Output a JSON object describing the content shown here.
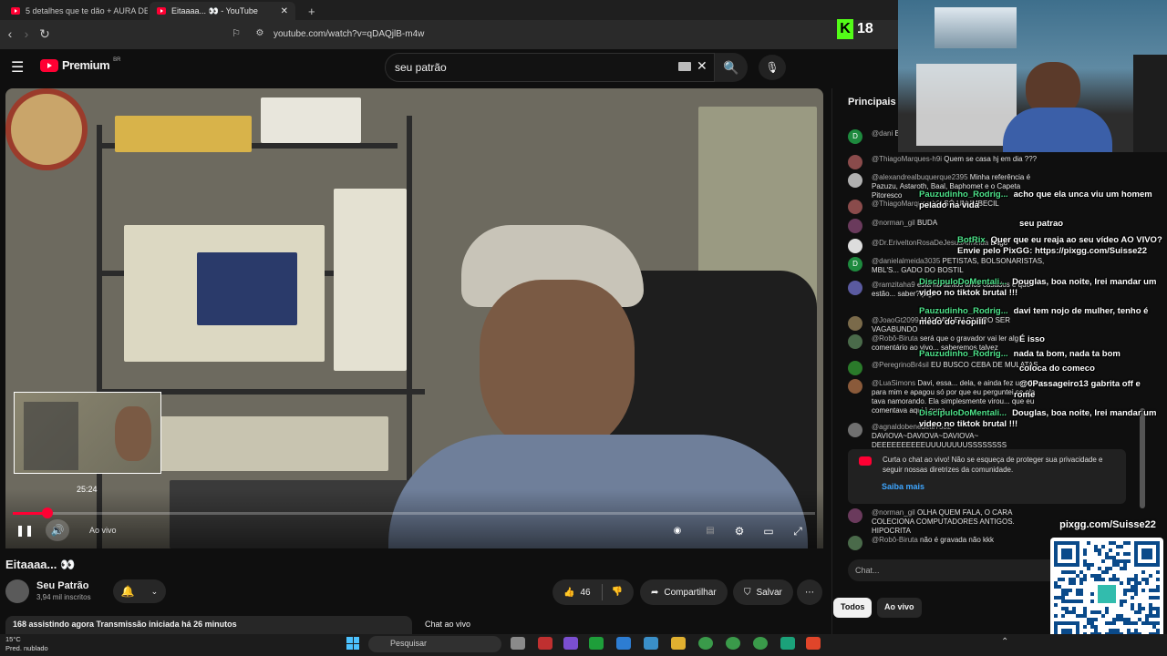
{
  "browser": {
    "tabs": [
      {
        "label": "5 detalhes que te dão + AURA DE H",
        "active": false
      },
      {
        "label": "Eitaaaa... 👀 - YouTube",
        "active": true
      }
    ],
    "new_tab": "+",
    "url": "youtube.com/watch?v=qDAQjlB-m4w"
  },
  "yt": {
    "brand": "Premium",
    "brand_region": "BR",
    "search_value": "seu patrão",
    "clear_glyph": "✕",
    "search_glyph": "🔍",
    "mic_glyph": "🎙"
  },
  "player": {
    "preview_time": "25:24",
    "live_label": "Ao vivo",
    "progress_fraction": 0.043
  },
  "video": {
    "title": "Eitaaaa... 👀",
    "channel": "Seu Patrão",
    "subscribers": "3,94 mil inscritos",
    "likes": "46",
    "share": "Compartilhar",
    "save": "Salvar",
    "info": "168 assistindo agora  Transmissão iniciada há 26 minutos"
  },
  "chat": {
    "header": "Principais m",
    "footer_label": "Chat ao vivo",
    "messages": [
      {
        "author": "@dani",
        "text": "BOSTIL",
        "color": "#1e8a3e",
        "initial": "D"
      },
      {
        "author": "@ThiagoMarques-h9i",
        "text": "Quem se casa hj em dia ???",
        "color": "#8a4b4b",
        "initial": ""
      },
      {
        "author": "@alexandrealbuquerque2395",
        "text": "Minha referência é Pazuzu, Astaroth, Baal, Baphomet e o Capeta Pitoresco",
        "color": "#b0b0b0",
        "initial": ""
      },
      {
        "author": "@ThiagoMarques-h9i",
        "text": "SÓ UM IMBECIL",
        "color": "#8a4b4b",
        "initial": ""
      },
      {
        "author": "@norman_gil",
        "text": "BUDA",
        "color": "#6a3a5c",
        "initial": ""
      },
      {
        "author": "@Dr.EriveltonRosaDeJesusAlmeida",
        "text": "Bago",
        "color": "#dddddd",
        "initial": ""
      },
      {
        "author": "@danielalmeida3035",
        "text": "PETISTAS, BOLSONARISTAS, MBL'S... GADO DO BOSTIL",
        "color": "#1e8a3e",
        "initial": "D"
      },
      {
        "author": "@ramzitaha9",
        "text": "está há tantos anos casados e que estão... saber?!pqp!",
        "color": "#5a5aa0",
        "initial": ""
      },
      {
        "author": "@JoaoGt2099",
        "text": "MAI DAVI EU QUERO SER VAGABUNDO",
        "color": "#7a6a4a",
        "initial": ""
      },
      {
        "author": "@Robô-Biruta",
        "text": "será que o gravador vai ler algo comentário ao vivo... saberemos talvez",
        "color": "#4a6a4a",
        "initial": ""
      },
      {
        "author": "@PeregrinoBr4sil",
        "text": "EU BUSCO CEBA DE MULATAS",
        "color": "#2a7a2a",
        "initial": ""
      },
      {
        "author": "@LuaSimons",
        "text": "Davi, essa... dela, e ainda fez um video para mim e apagou só por que eu perguntei se ela tava namorando. Ela simplesmente virou... que eu comentava aqui.Louca",
        "color": "#8a5a3a",
        "initial": ""
      },
      {
        "author": "@agnaldobenedetti7532",
        "text": "DAVIOVA~DAVIOVA~DAVIOVA~ DEEEEEEEEEEUUUUUUUUSSSSSSSS",
        "color": "#707070",
        "initial": ""
      },
      {
        "author": "@norman_gil",
        "text": "OLHA QUEM FALA, O CARA COLECIONA COMPUTADORES ANTIGOS. HIPOCRITA",
        "color": "#6a3a5c",
        "initial": ""
      },
      {
        "author": "@Robô-Biruta",
        "text": "não é gravada não kkk",
        "color": "#4a6a4a",
        "initial": ""
      }
    ],
    "notice": "Curta o chat ao vivo! Não se esqueça de proteger sua privacidade e seguir nossas diretrizes da comunidade.",
    "learn_more": "Saiba mais",
    "input_placeholder": "Chat...",
    "chips": [
      "Todos",
      "Ao vivo"
    ]
  },
  "overlay": {
    "kick_count": "18",
    "kick_letter": "K",
    "messages": [
      {
        "user": "Pauzudinho_Rodrig...",
        "text": "acho que ela unca viu um homem pelado na vida"
      },
      {
        "user": "",
        "text": "seu patrao"
      },
      {
        "user": "BotRix",
        "text": "Quer que eu reaja ao seu vídeo AO VIVO? Envie pelo PixGG: https://pixgg.com/Suisse22"
      },
      {
        "user": "DiscipuloDoMentali...",
        "text": "Douglas, boa noite, Irei mandar um video no tiktok brutal !!!"
      },
      {
        "user": "Pauzudinho_Rodrig...",
        "text": "davi tem nojo de mulher, tenho é medo do reopilli"
      },
      {
        "user": "",
        "text": "É isso"
      },
      {
        "user": "Pauzudinho_Rodrig...",
        "text": "nada ta bom, nada ta bom"
      },
      {
        "user": "",
        "text": "coloca do comeco"
      },
      {
        "user": "",
        "text": "@0Passageiro13 gabrita off e rome"
      },
      {
        "user": "DiscipuloDoMentali...",
        "text": "Douglas, boa noite, Irei mandar um video no tiktok brutal !!!"
      }
    ],
    "pix_title": "pixgg.com/Suisse22"
  },
  "taskbar": {
    "temp": "15°C",
    "weather": "Pred. nublado",
    "search_placeholder": "Pesquisar"
  },
  "colors": {
    "accent": "#ff0033",
    "kick": "#53fc18",
    "link": "#3ea6ff"
  }
}
